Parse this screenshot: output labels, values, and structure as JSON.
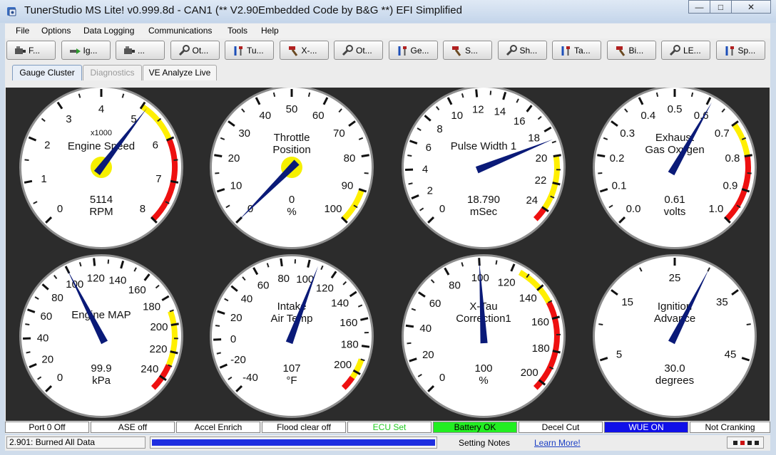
{
  "window": {
    "title": "TunerStudio MS Lite! v0.999.8d - CAN1 (** V2.90Embedded Code by B&G **) EFI Simplified",
    "minimize": "—",
    "maximize": "□",
    "close": "✕"
  },
  "menu": [
    "File",
    "Options",
    "Data Logging",
    "Communications",
    "Tools",
    "Help"
  ],
  "toolbar": [
    {
      "label": "F...",
      "icon": "engine-icon"
    },
    {
      "label": "Ig...",
      "icon": "spark-icon"
    },
    {
      "label": "...",
      "icon": "engine-icon"
    },
    {
      "label": "Ot...",
      "icon": "wrench-icon"
    },
    {
      "label": "Tu...",
      "icon": "tools-icon"
    },
    {
      "label": "X-...",
      "icon": "hammer-icon"
    },
    {
      "label": "Ot...",
      "icon": "wrench-icon"
    },
    {
      "label": "Ge...",
      "icon": "tools-icon"
    },
    {
      "label": "S...",
      "icon": "hammer-icon"
    },
    {
      "label": "Sh...",
      "icon": "wrench-icon"
    },
    {
      "label": "Ta...",
      "icon": "tools-icon"
    },
    {
      "label": "Bi...",
      "icon": "hammer-icon"
    },
    {
      "label": "LE...",
      "icon": "wrench-icon"
    },
    {
      "label": "Sp...",
      "icon": "tools-icon"
    }
  ],
  "tabs": [
    {
      "label": "Gauge Cluster",
      "state": "active"
    },
    {
      "label": "Diagnostics",
      "state": "disabled"
    },
    {
      "label": "VE Analyze Live",
      "state": "normal"
    }
  ],
  "gauges": [
    {
      "title": [
        "Engine Speed"
      ],
      "sub": "x1000",
      "value": "5114",
      "units": "RPM",
      "min": 0,
      "max": 8,
      "current": 5.114,
      "ticks": [
        "0",
        "1",
        "2",
        "3",
        "4",
        "5",
        "6",
        "7",
        "8"
      ],
      "warn_from": 5.0,
      "danger_from": 6.0,
      "hub": true
    },
    {
      "title": [
        "Throttle",
        "Position"
      ],
      "value": "0",
      "units": "%",
      "min": 0,
      "max": 100,
      "current": 0,
      "ticks": [
        "0",
        "10",
        "20",
        "30",
        "40",
        "50",
        "60",
        "70",
        "80",
        "90",
        "100"
      ],
      "warn_from": 90,
      "hub": true
    },
    {
      "title": [
        "Pulse Width 1"
      ],
      "value": "18.790",
      "units": "mSec",
      "min": 0,
      "max": 25,
      "current": 18.79,
      "ticks": [
        "0",
        "2",
        "4",
        "6",
        "8",
        "10",
        "12",
        "14",
        "16",
        "18",
        "20",
        "22",
        "24"
      ],
      "warn_from": 20.0,
      "danger_from": 24.0
    },
    {
      "title": [
        "Exhaust",
        "Gas Oxygen"
      ],
      "value": "0.61",
      "units": "volts",
      "min": 0,
      "max": 1,
      "current": 0.61,
      "ticks": [
        "0.0",
        "0.1",
        "0.2",
        "0.3",
        "0.4",
        "0.5",
        "0.6",
        "0.7",
        "0.8",
        "0.9",
        "1.0"
      ],
      "warn_from": 0.7,
      "danger_from": 0.8
    },
    {
      "title": [
        "Engine MAP"
      ],
      "value": "99.9",
      "units": "kPa",
      "min": 0,
      "max": 250,
      "current": 99.9,
      "ticks": [
        "0",
        "20",
        "40",
        "60",
        "80",
        "100",
        "120",
        "140",
        "160",
        "180",
        "200",
        "220",
        "240"
      ],
      "warn_from": 190,
      "danger_from": 230
    },
    {
      "title": [
        "Intake",
        "Air Temp"
      ],
      "value": "107",
      "units": "°F",
      "min": -40,
      "max": 215,
      "current": 107,
      "ticks": [
        "-40",
        "-20",
        "0",
        "20",
        "40",
        "60",
        "80",
        "100",
        "120",
        "140",
        "160",
        "180",
        "200"
      ],
      "warn_from": 190,
      "danger_from": 205
    },
    {
      "title": [
        "X-Tau",
        "Correction1"
      ],
      "value": "100",
      "units": "%",
      "min": 0,
      "max": 205,
      "current": 100,
      "ticks": [
        "0",
        "20",
        "40",
        "60",
        "80",
        "100",
        "120",
        "140",
        "160",
        "180",
        "200"
      ],
      "warn_from": 125,
      "danger_from": 150
    },
    {
      "title": [
        "Ignition",
        "Advance"
      ],
      "value": "30.0",
      "units": "degrees",
      "min": 0,
      "max": 50,
      "current": 30,
      "ticks": [
        "5",
        "15",
        "25",
        "35",
        "45"
      ]
    }
  ],
  "indicators": [
    {
      "label": "Port 0 Off",
      "bg": "#ffffff",
      "fg": "#000000"
    },
    {
      "label": "ASE off",
      "bg": "#ffffff",
      "fg": "#000000"
    },
    {
      "label": "Accel Enrich",
      "bg": "#ffffff",
      "fg": "#000000"
    },
    {
      "label": "Flood clear off",
      "bg": "#ffffff",
      "fg": "#000000"
    },
    {
      "label": "ECU Set",
      "bg": "#ffffff",
      "fg": "#22cc22"
    },
    {
      "label": "Battery OK",
      "bg": "#22ee22",
      "fg": "#000000"
    },
    {
      "label": "Decel Cut",
      "bg": "#ffffff",
      "fg": "#000000"
    },
    {
      "label": "WUE ON",
      "bg": "#1010e8",
      "fg": "#ffffff"
    },
    {
      "label": "Not Cranking",
      "bg": "#ffffff",
      "fg": "#000000"
    }
  ],
  "status": {
    "message": "2.901: Burned All Data",
    "progress": 1.0,
    "setting_notes": "Setting Notes",
    "learn_more": "Learn More!"
  },
  "colors": {
    "needle": "#0a1a78",
    "warn": "#ffef00",
    "danger": "#ee1010",
    "hub": "#f6f000",
    "panel": "#2c2c2c"
  }
}
